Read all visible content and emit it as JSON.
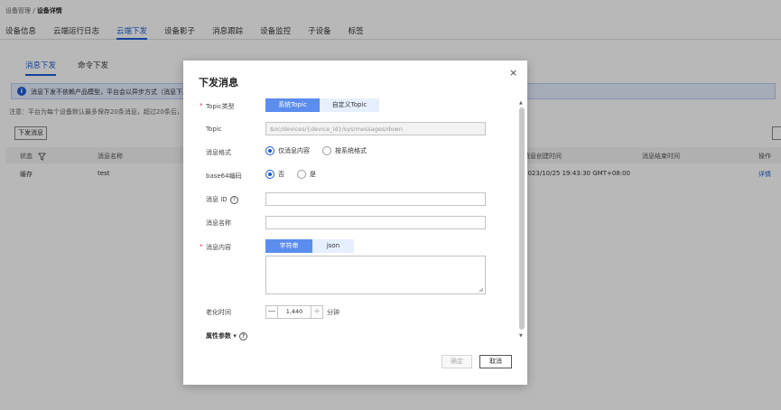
{
  "breadcrumb": {
    "parent": "设备管理 / ",
    "current": "设备详情"
  },
  "main_tabs": [
    "设备信息",
    "云端运行日志",
    "云端下发",
    "设备影子",
    "消息跟踪",
    "设备监控",
    "子设备",
    "标签"
  ],
  "sub_tabs": [
    "消息下发",
    "命令下发"
  ],
  "info_text": "消息下发不依赖产品模型，平台会以异步方式（消息下发",
  "note_text": "注意：平台为每个设备默认最多保存20条消息，超过20条后，后",
  "send_button": "下发消息",
  "table": {
    "headers": {
      "status": "状态",
      "name": "消息名称",
      "create_time": "消息创建时间",
      "end_time": "消息结束时间",
      "action": "操作"
    },
    "row": {
      "status": "缓存",
      "name": "test",
      "create_time": "2023/10/25 19:43:30 GMT+08:00",
      "action": "详情"
    }
  },
  "dialog": {
    "title": "下发消息",
    "close": "×",
    "fields": {
      "topic_type": {
        "label": "Topic类型",
        "options": [
          "系统Topic",
          "自定义Topic"
        ],
        "selected": "系统Topic"
      },
      "topic": {
        "label": "Topic",
        "value": "$oc/devices/{device_id}/sys/messages/down"
      },
      "format": {
        "label": "消息格式",
        "options": [
          "仅消息内容",
          "按系统格式"
        ],
        "selected": "仅消息内容"
      },
      "base64": {
        "label": "base64编码",
        "options": [
          "否",
          "是"
        ],
        "selected": "否"
      },
      "message_id": {
        "label": "消息 ID",
        "value": ""
      },
      "message_name": {
        "label": "消息名称",
        "value": ""
      },
      "content": {
        "label": "消息内容",
        "options": [
          "字符串",
          "json"
        ],
        "selected": "字符串",
        "value": ""
      },
      "aging": {
        "label": "老化时间",
        "value": "1,440",
        "unit": "分钟",
        "minus": "—",
        "plus": "+"
      }
    },
    "properties_label": "属性参数 ▾",
    "ok": "确定",
    "cancel": "取消"
  },
  "colors": {
    "primary": "#1a5cd6",
    "segment_on": "#5b8def",
    "segment_off": "#e6efff",
    "required": "#e53935"
  }
}
